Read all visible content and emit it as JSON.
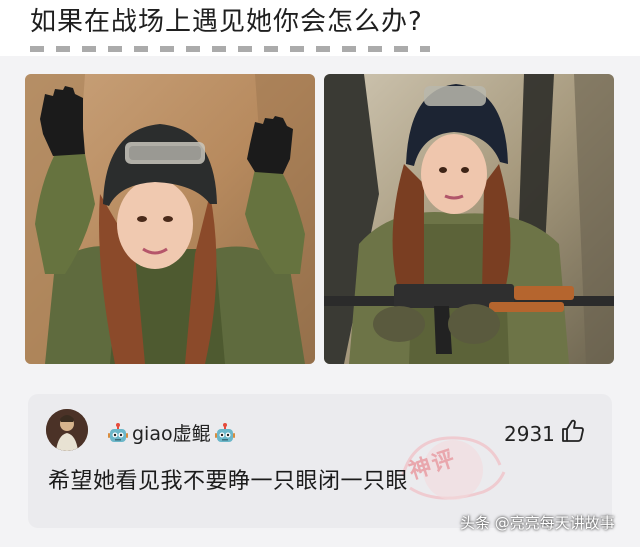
{
  "question": {
    "title": "如果在战场上遇见她你会怎么办?"
  },
  "comment": {
    "username": "giao虚鲲",
    "like_count": "2931",
    "text": "希望她看见我不要睁一只眼闭一只眼",
    "stamp_label": "神评"
  },
  "watermark": {
    "text": "头条 @亮亮每天讲故事"
  },
  "icons": {
    "robot": "robot-emoji-icon",
    "thumb": "thumbs-up-icon",
    "avatar": "user-avatar"
  },
  "colors": {
    "card_bg": "#ebebee",
    "page_bg": "#f3f3f5",
    "stamp": "#e9a7ad"
  }
}
